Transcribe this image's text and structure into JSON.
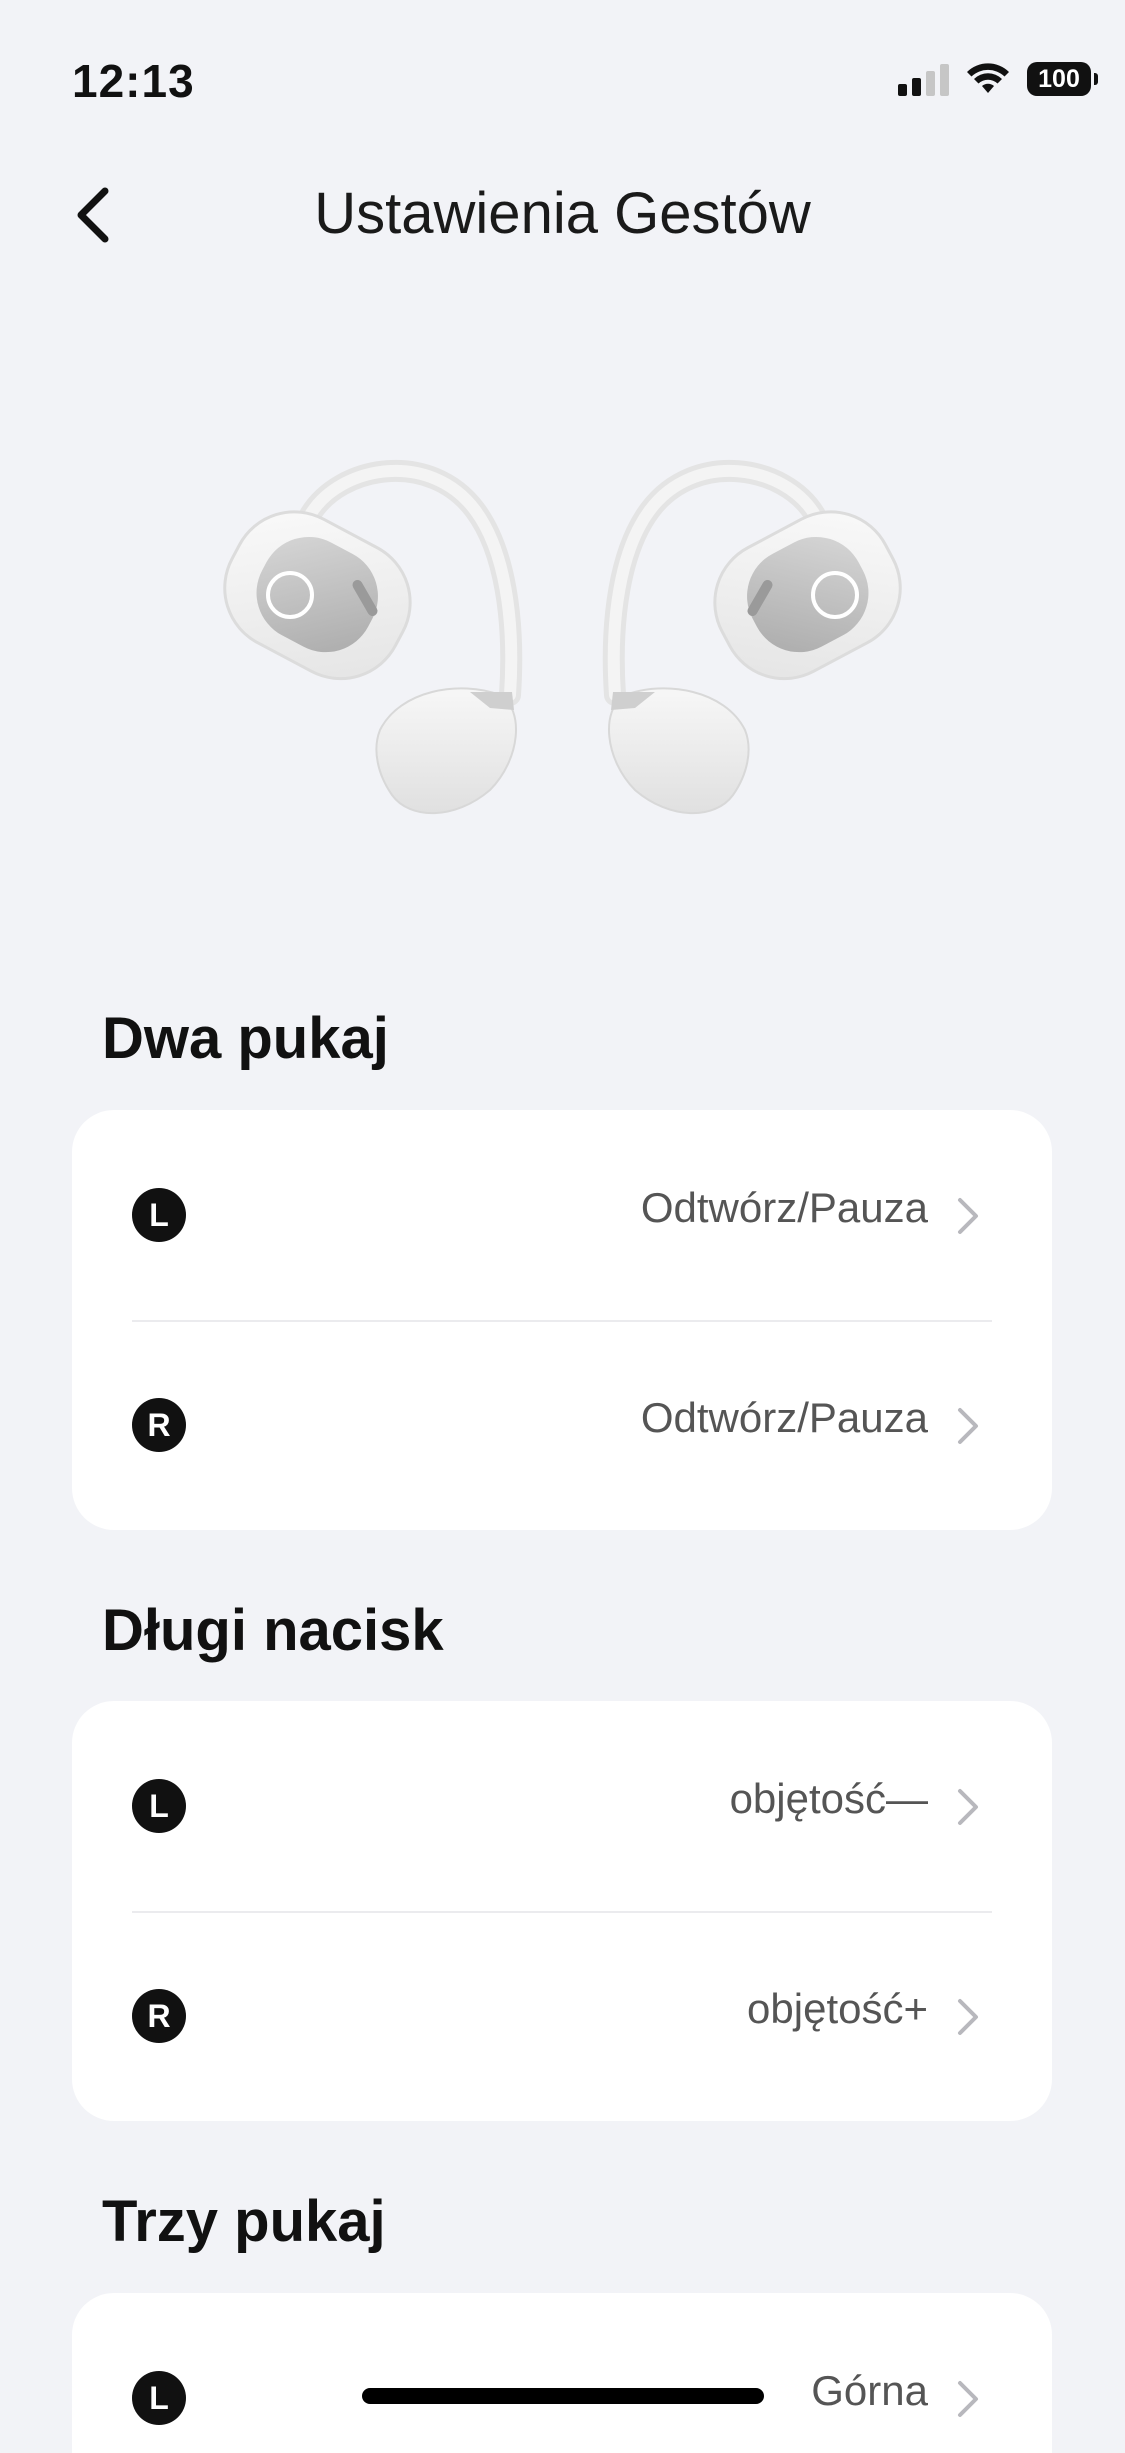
{
  "status_bar": {
    "time": "12:13",
    "battery": "100"
  },
  "header": {
    "title": "Ustawienia Gestów"
  },
  "sections": [
    {
      "title": "Dwa pukaj",
      "rows": [
        {
          "side": "L",
          "value": "Odtwórz/Pauza"
        },
        {
          "side": "R",
          "value": "Odtwórz/Pauza"
        }
      ]
    },
    {
      "title": "Długi nacisk",
      "rows": [
        {
          "side": "L",
          "value": "objętość—"
        },
        {
          "side": "R",
          "value": "objętość+"
        }
      ]
    },
    {
      "title": "Trzy pukaj",
      "rows": [
        {
          "side": "L",
          "value": "Górna"
        }
      ]
    }
  ],
  "colors": {
    "background": "#f2f3f7",
    "card": "#ffffff",
    "badge": "#111111",
    "value_text": "#555555",
    "chevron": "#b8b8bd"
  }
}
